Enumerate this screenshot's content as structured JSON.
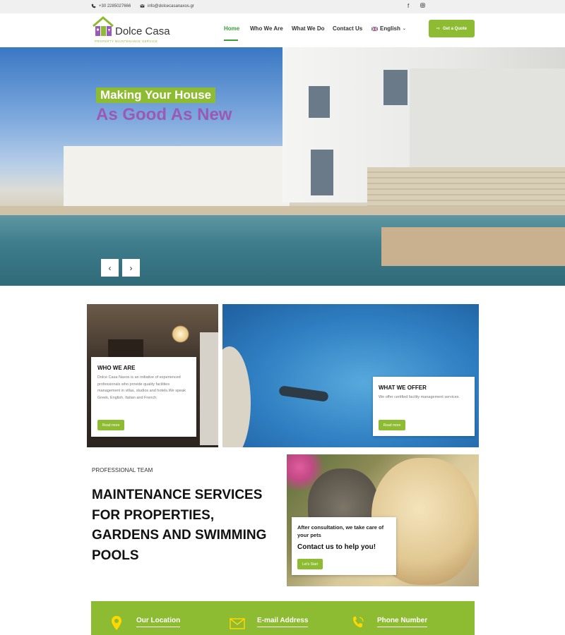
{
  "topbar": {
    "phone": "+30 2285027666",
    "email": "info@dolcecasanaxos.gr",
    "social": [
      "facebook-icon",
      "instagram-icon"
    ]
  },
  "header": {
    "brand": "Dolce Casa",
    "tagline": "PROPERTY MAINTENANCE SERVICE",
    "nav": [
      "Home",
      "Who We Are",
      "What We Do",
      "Contact Us"
    ],
    "active_nav": "Home",
    "language": "English",
    "quote_button": "Get a Quote"
  },
  "hero": {
    "line1": "Making Your House",
    "line2": "As Good As New",
    "prev": "‹",
    "next": "›"
  },
  "who": {
    "title": "WHO WE ARE",
    "text": "Dolce Casa Naxos is an initiative of experienced professionals who provide quality facilities management in villas, studios and hotels.We speak Greek, English, Italian and French.",
    "button": "Read more"
  },
  "offer": {
    "title": "WHAT WE OFFER",
    "text": "We offer certified facility management services.",
    "button": "Read more"
  },
  "professional": {
    "label": "PROFESSIONAL TEAM",
    "title": "MAINTENANCE SERVICES FOR PROPERTIES, GARDENS AND SWIMMING POOLS"
  },
  "pets": {
    "text": "After consultation, we take care of your pets",
    "cta": "Contact us to help you!",
    "button": "Let's Start"
  },
  "contact": {
    "location": "Our Location",
    "email": "E-mail Address",
    "phone": "Phone Number"
  },
  "colors": {
    "accent": "#8dbb31",
    "purple": "#9b59b6",
    "nav_active": "#3a9f3a"
  }
}
